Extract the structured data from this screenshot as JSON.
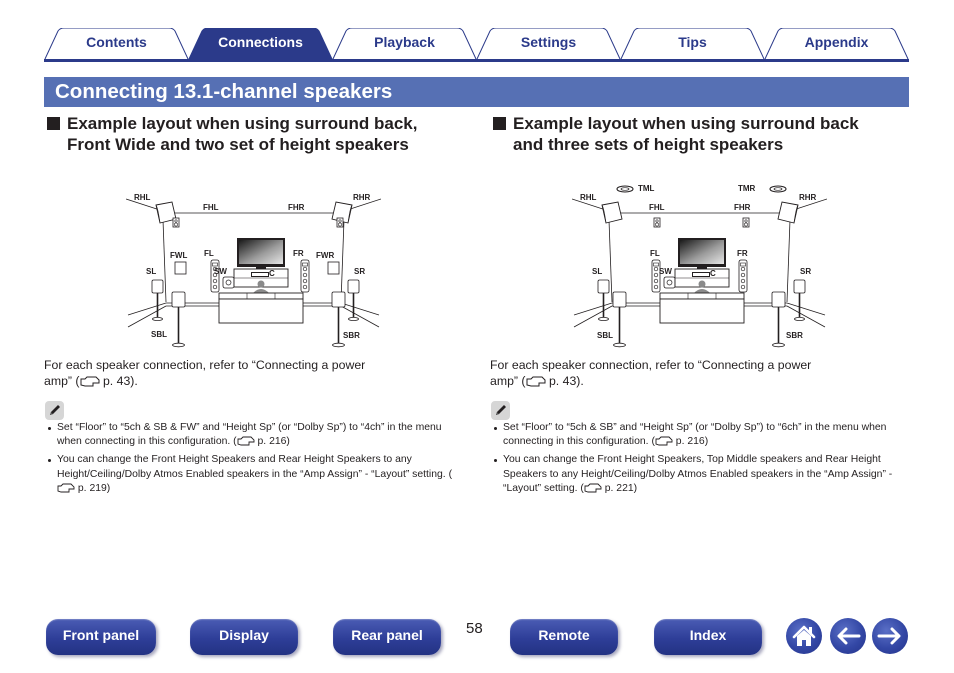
{
  "tabs": [
    {
      "label": "Contents",
      "active": false
    },
    {
      "label": "Connections",
      "active": true
    },
    {
      "label": "Playback",
      "active": false
    },
    {
      "label": "Settings",
      "active": false
    },
    {
      "label": "Tips",
      "active": false
    },
    {
      "label": "Appendix",
      "active": false
    }
  ],
  "page_title": "Connecting 13.1-channel speakers",
  "colors": {
    "brand_blue": "#2b3a8a",
    "title_bar": "#5670b4",
    "text": "#231f20"
  },
  "left_section": {
    "heading_line1": "Example layout when using surround back,",
    "heading_line2": "Front Wide and two set of height speakers",
    "speaker_labels": {
      "rhl": "RHL",
      "rhr": "RHR",
      "fhl": "FHL",
      "fhr": "FHR",
      "fwl": "FWL",
      "fwr": "FWR",
      "fl": "FL",
      "fr": "FR",
      "sl": "SL",
      "sr": "SR",
      "sw": "SW",
      "c": "C",
      "sbl": "SBL",
      "sbr": "SBR"
    },
    "body_line1": "For each speaker connection, refer to “Connecting a power",
    "body_line2_pre": "amp” (",
    "body_line2_post": " p. 43).",
    "notes": [
      {
        "text": "Set “Floor” to “5ch & SB & FW” and “Height Sp” (or “Dolby Sp”) to “4ch” in the menu when connecting in this configuration.  (",
        "ref": " p. 216)"
      },
      {
        "text": "You can change the Front Height Speakers and Rear Height Speakers to any Height/Ceiling/Dolby Atmos Enabled speakers in the “Amp Assign” - “Layout” setting.  (",
        "ref": " p. 219)"
      }
    ]
  },
  "right_section": {
    "heading_line1": "Example layout when using surround back",
    "heading_line2": "and three sets of height speakers",
    "speaker_labels": {
      "rhl": "RHL",
      "rhr": "RHR",
      "fhl": "FHL",
      "fhr": "FHR",
      "tml": "TML",
      "tmr": "TMR",
      "fl": "FL",
      "fr": "FR",
      "sl": "SL",
      "sr": "SR",
      "sw": "SW",
      "c": "C",
      "sbl": "SBL",
      "sbr": "SBR"
    },
    "body_line1": "For each speaker connection, refer to “Connecting a power",
    "body_line2_pre": "amp” (",
    "body_line2_post": " p. 43).",
    "notes": [
      {
        "text": "Set “Floor” to “5ch & SB” and “Height Sp” (or “Dolby Sp”) to “6ch” in the menu when connecting in this configuration.  (",
        "ref": " p. 216)"
      },
      {
        "text": "You can change the Front Height Speakers, Top Middle speakers and Rear Height Speakers to any Height/Ceiling/Dolby Atmos Enabled speakers in the “Amp Assign” - “Layout” setting.  (",
        "ref": " p. 221)"
      }
    ]
  },
  "bottom_nav": {
    "front_panel": "Front panel",
    "display": "Display",
    "rear_panel": "Rear panel",
    "page_number": "58",
    "remote": "Remote",
    "index": "Index",
    "icons": [
      "home-icon",
      "back-arrow-icon",
      "forward-arrow-icon"
    ]
  }
}
